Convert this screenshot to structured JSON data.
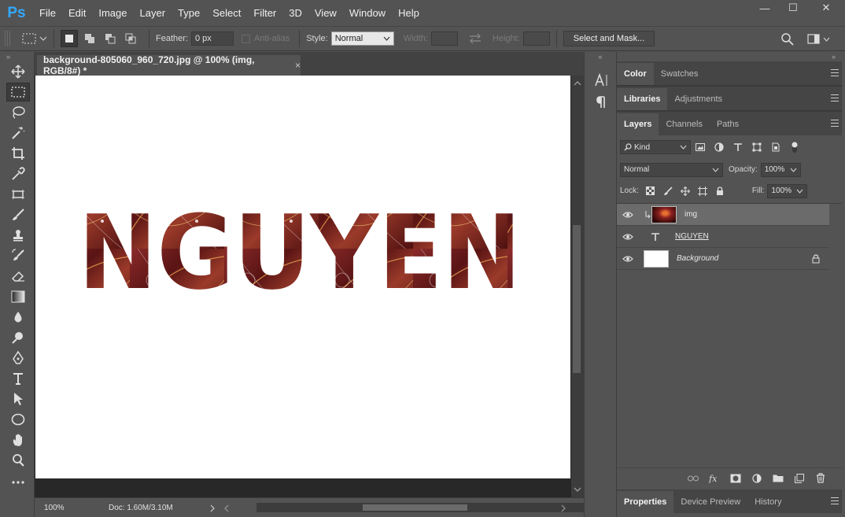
{
  "app": {
    "logo": "Ps"
  },
  "menu": [
    "File",
    "Edit",
    "Image",
    "Layer",
    "Type",
    "Select",
    "Filter",
    "3D",
    "View",
    "Window",
    "Help"
  ],
  "window_controls": {
    "minimize": "—",
    "restore": "☐",
    "close": "✕"
  },
  "options": {
    "feather_label": "Feather:",
    "feather_value": "0 px",
    "antialias_label": "Anti-alias",
    "style_label": "Style:",
    "style_value": "Normal",
    "width_label": "Width:",
    "height_label": "Height:",
    "select_mask_label": "Select and Mask..."
  },
  "document": {
    "tab_title": "background-805060_960_720.jpg @ 100% (img, RGB/8#) *",
    "tab_close": "×",
    "canvas_text": "NGUYEN"
  },
  "status": {
    "zoom": "100%",
    "doc_info": "Doc: 1.60M/3.10M"
  },
  "panels": {
    "group1": [
      "Color",
      "Swatches"
    ],
    "group2": [
      "Libraries",
      "Adjustments"
    ],
    "group3": [
      "Layers",
      "Channels",
      "Paths"
    ],
    "group4": [
      "Properties",
      "Device Preview",
      "History"
    ]
  },
  "layers_panel": {
    "kind_label": "Kind",
    "blend_mode": "Normal",
    "opacity_label": "Opacity:",
    "opacity_value": "100%",
    "lock_label": "Lock:",
    "fill_label": "Fill:",
    "fill_value": "100%",
    "layers": [
      {
        "name": "img",
        "type": "image-clipped",
        "selected": true
      },
      {
        "name": "NGUYEN",
        "type": "text",
        "selected": false
      },
      {
        "name": "Background",
        "type": "background",
        "selected": false,
        "locked": true
      }
    ]
  },
  "icons": {
    "tools": [
      "move-icon",
      "marquee-icon",
      "lasso-icon",
      "magic-wand-icon",
      "crop-icon",
      "eyedropper-icon",
      "healing-icon",
      "brush-icon",
      "stamp-icon",
      "history-brush-icon",
      "eraser-icon",
      "gradient-icon",
      "blur-icon",
      "dodge-icon",
      "pen-icon",
      "type-icon",
      "path-select-icon",
      "ellipse-icon",
      "hand-icon",
      "zoom-icon",
      "more-tools-icon"
    ]
  },
  "colors": {
    "accent_logo": "#31a8ff",
    "panel_bg": "#535353",
    "canvas_text_fill": "#6e1c1c"
  }
}
